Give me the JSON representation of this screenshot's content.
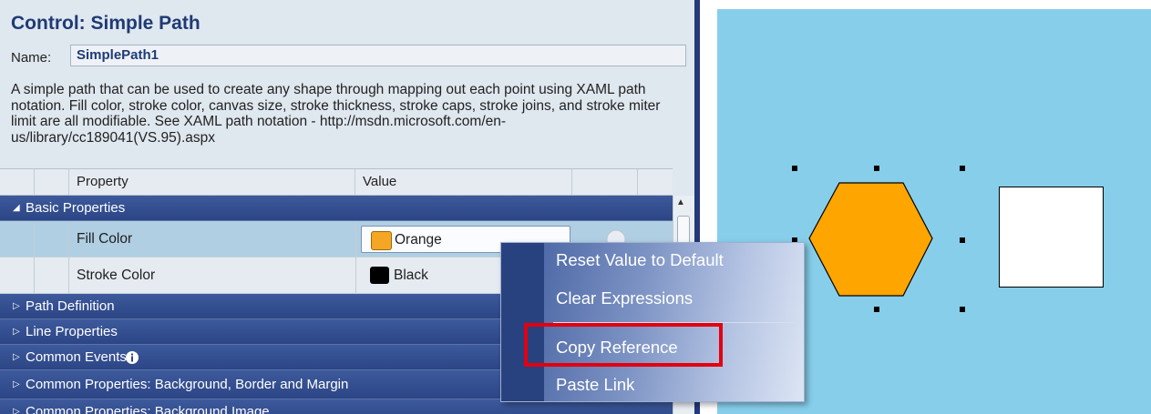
{
  "panel": {
    "title": "Control: Simple Path",
    "name_label": "Name:",
    "name_value": "SimplePath1",
    "description": "A simple path that can be used to create any shape through mapping out each point using XAML path notation. Fill color, stroke color, canvas size, stroke thickness, stroke caps, stroke joins, and stroke miter limit are all modifiable. See XAML path notation - http://msdn.microsoft.com/en-us/library/cc189041(VS.95).aspx"
  },
  "grid": {
    "columns": [
      "Property",
      "Value"
    ],
    "groups": [
      {
        "label": "Basic Properties",
        "expanded": true
      },
      {
        "label": "Path Definition",
        "expanded": false
      },
      {
        "label": "Line Properties",
        "expanded": false
      },
      {
        "label": "Common Events",
        "expanded": false,
        "icon": "info-icon"
      },
      {
        "label": "Common Properties: Background, Border and Margin",
        "expanded": false
      },
      {
        "label": "Common Properties: Background Image",
        "expanded": false
      }
    ],
    "rows": [
      {
        "name": "Fill Color",
        "value": "Orange",
        "swatch": "#f5a623"
      },
      {
        "name": "Stroke Color",
        "value": "Black",
        "swatch": "#000000"
      }
    ]
  },
  "context_menu": {
    "items": [
      "Reset Value to Default",
      "Clear Expressions",
      "Copy Reference",
      "Paste Link"
    ],
    "highlighted": "Copy Reference"
  },
  "canvas": {
    "background": "#87ceeb",
    "hexagon_fill": "#ffa500"
  }
}
